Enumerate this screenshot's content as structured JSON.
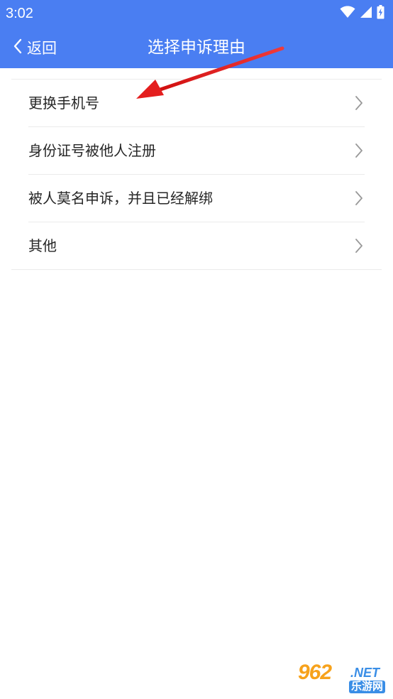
{
  "status_bar": {
    "time": "3:02",
    "icons": [
      "wifi-icon",
      "signal-icon",
      "battery-charging-icon"
    ]
  },
  "nav": {
    "back_label": "返回",
    "title": "选择申诉理由"
  },
  "reasons": [
    {
      "label": "更换手机号"
    },
    {
      "label": "身份证号被他人注册"
    },
    {
      "label": "被人莫名申诉，并且已经解绑"
    },
    {
      "label": "其他"
    }
  ],
  "watermark": {
    "brand_number": "962",
    "brand_suffix": ".NET",
    "brand_name": "乐游网"
  },
  "colors": {
    "header": "#4a7ef2",
    "annotation_arrow": "#e41e1e",
    "chevron": "#999999"
  }
}
